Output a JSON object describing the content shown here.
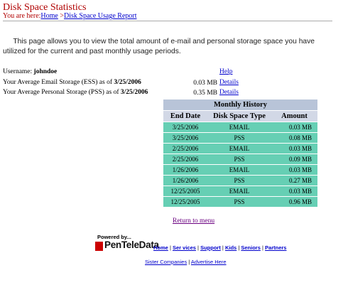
{
  "header": {
    "title": "Disk Space Statistics",
    "breadcrumb_prefix": "You are here:",
    "breadcrumb_home": "Home",
    "breadcrumb_sep": " >",
    "breadcrumb_current": "Disk Space Usage Report"
  },
  "intro": "This page allows you to view the total amount of e-mail and personal storage space you have utilized for the current and past monthly usage periods.",
  "account": {
    "username_label": "Username:",
    "username": "johndoe",
    "help_link": "Help",
    "ess_label": "Your Average Email Storage (ESS) as of",
    "ess_date": "3/25/2006",
    "ess_value": "0.03 MB",
    "ess_details": "Details",
    "pss_label": "Your Average Personal Storage (PSS) as of",
    "pss_date": "3/25/2006",
    "pss_value": "0.35 MB",
    "pss_details": "Details"
  },
  "history": {
    "title": "Monthly History",
    "columns": [
      "End Date",
      "Disk Space Type",
      "Amount"
    ],
    "rows": [
      [
        "3/25/2006",
        "EMAIL",
        "0.03 MB"
      ],
      [
        "3/25/2006",
        "PSS",
        "0.08 MB"
      ],
      [
        "2/25/2006",
        "EMAIL",
        "0.03 MB"
      ],
      [
        "2/25/2006",
        "PSS",
        "0.09 MB"
      ],
      [
        "1/26/2006",
        "EMAIL",
        "0.03 MB"
      ],
      [
        "1/26/2006",
        "PSS",
        "0.27 MB"
      ],
      [
        "12/25/2005",
        "EMAIL",
        "0.03 MB"
      ],
      [
        "12/25/2005",
        "PSS",
        "0.96 MB"
      ]
    ]
  },
  "return_link": "Return to menu",
  "footer": {
    "powered_by": "Powered by...",
    "logo_text": "PenTeleData",
    "nav": [
      "Home",
      "Ser vices",
      "Support",
      "Kids",
      "Seniors",
      "Partners"
    ],
    "separator": "|",
    "links2": [
      "Sister Companies",
      "Advertise Here"
    ]
  },
  "colors": {
    "title_red": "#b00000",
    "link_blue": "#0000cc",
    "row_teal": "#66cfb4",
    "header_blue": "#b8c4d8",
    "logo_red": "#cc0000"
  }
}
